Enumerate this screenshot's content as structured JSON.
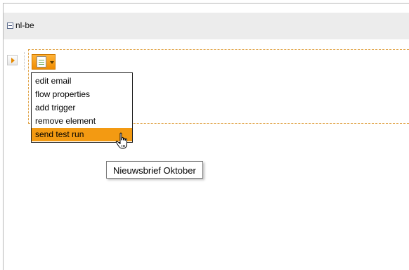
{
  "tree": {
    "root_label": "nl-be"
  },
  "node": {
    "icon": "document-icon",
    "dropdown_icon": "chevron-down-icon"
  },
  "context_menu": {
    "items": [
      {
        "label": "edit email"
      },
      {
        "label": "flow properties"
      },
      {
        "label": "add trigger"
      },
      {
        "label": "remove element"
      },
      {
        "label": "send test run"
      }
    ],
    "highlighted_index": 4
  },
  "tooltip": {
    "text": "Nieuwsbrief Oktober"
  },
  "colors": {
    "highlight": "#f39a12",
    "drop_zone_border": "#e0a040",
    "header_bg": "#ececec"
  }
}
